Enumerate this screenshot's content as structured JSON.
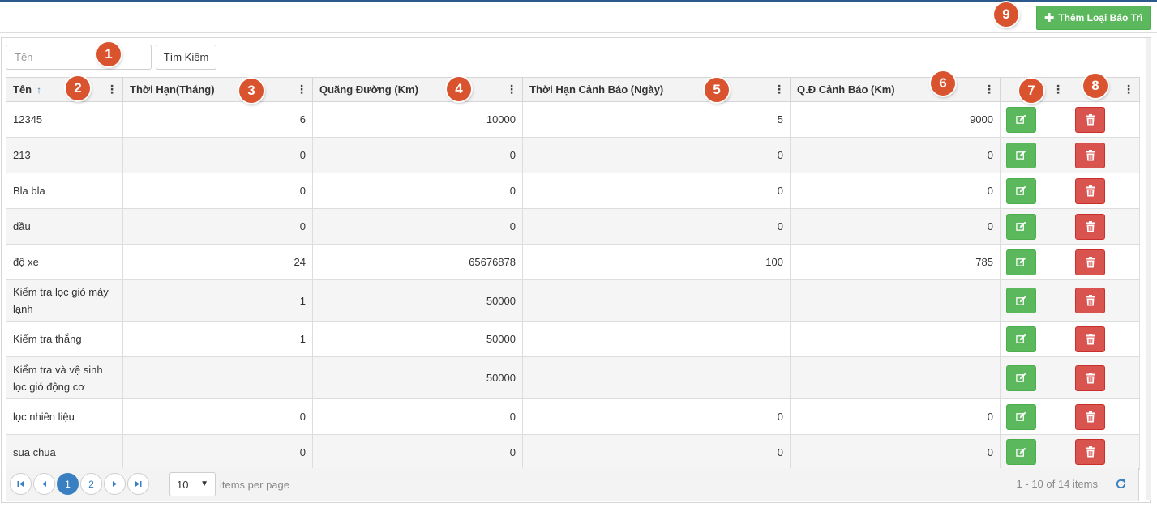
{
  "toolbar": {
    "add_label": "Thêm Loại Bảo Trì"
  },
  "search": {
    "placeholder": "Tên",
    "button_label": "Tìm Kiếm"
  },
  "columns": [
    {
      "label": "Tên",
      "sorted": "asc"
    },
    {
      "label": "Thời Hạn(Tháng)"
    },
    {
      "label": "Quãng Đường (Km)"
    },
    {
      "label": "Thời Hạn Cảnh Báo (Ngày)"
    },
    {
      "label": "Q.Đ Cảnh Báo (Km)"
    },
    {
      "label": ""
    },
    {
      "label": ""
    }
  ],
  "rows": [
    {
      "name": "12345",
      "months": "6",
      "km": "10000",
      "warn_days": "5",
      "warn_km": "9000"
    },
    {
      "name": "213",
      "months": "0",
      "km": "0",
      "warn_days": "0",
      "warn_km": "0"
    },
    {
      "name": "Bla bla",
      "months": "0",
      "km": "0",
      "warn_days": "0",
      "warn_km": "0"
    },
    {
      "name": "dầu",
      "months": "0",
      "km": "0",
      "warn_days": "0",
      "warn_km": "0"
    },
    {
      "name": "độ xe",
      "months": "24",
      "km": "65676878",
      "warn_days": "100",
      "warn_km": "785"
    },
    {
      "name": "Kiểm tra lọc gió máy lạnh",
      "months": "1",
      "km": "50000",
      "warn_days": "",
      "warn_km": ""
    },
    {
      "name": "Kiểm tra thắng",
      "months": "1",
      "km": "50000",
      "warn_days": "",
      "warn_km": ""
    },
    {
      "name": "Kiểm tra và vệ sinh lọc gió động cơ",
      "months": "",
      "km": "50000",
      "warn_days": "",
      "warn_km": ""
    },
    {
      "name": "lọc nhiên liệu",
      "months": "0",
      "km": "0",
      "warn_days": "0",
      "warn_km": "0"
    },
    {
      "name": "sua chua",
      "months": "0",
      "km": "0",
      "warn_days": "0",
      "warn_km": "0"
    }
  ],
  "pager": {
    "pages": [
      "1",
      "2"
    ],
    "current_page": "1",
    "page_size": "10",
    "per_page_label": "items per page",
    "info": "1 - 10 of 14 items"
  },
  "annotations": [
    "1",
    "2",
    "3",
    "4",
    "5",
    "6",
    "7",
    "8",
    "9"
  ],
  "colors": {
    "success": "#5cb85c",
    "danger": "#d9534f",
    "primary": "#3a7fc1",
    "badge": "#d9532f"
  },
  "icons": [
    "plus-icon",
    "sort-asc-icon",
    "kebab-icon",
    "edit-icon",
    "trash-icon",
    "first-page-icon",
    "prev-page-icon",
    "next-page-icon",
    "last-page-icon",
    "caret-down-icon",
    "refresh-icon"
  ]
}
